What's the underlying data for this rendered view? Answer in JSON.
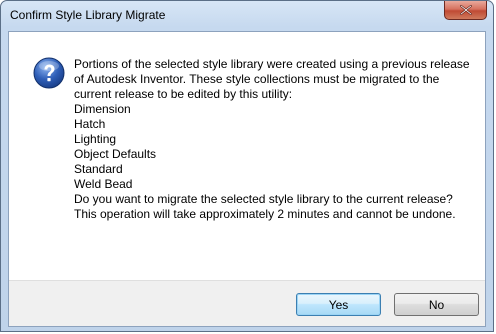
{
  "window": {
    "title": "Confirm Style Library Migrate"
  },
  "icons": {
    "close": "close-icon",
    "message": "question-icon"
  },
  "message": {
    "intro": "Portions of the selected style library were created using a previous release of Autodesk Inventor. These style collections must be migrated to the current release to be edited by this utility:",
    "styles": [
      "Dimension",
      "Hatch",
      "Lighting",
      "Object Defaults",
      "Standard",
      "Weld Bead"
    ],
    "question": "Do you want to migrate the selected style library to the current release? This operation will take approximately 2 minutes and cannot be undone."
  },
  "buttons": {
    "yes_label": "Yes",
    "no_label": "No"
  },
  "colors": {
    "close_button": "#c9553f",
    "icon_blue": "#2f5fb8",
    "default_button_border": "#3c7fb1"
  }
}
